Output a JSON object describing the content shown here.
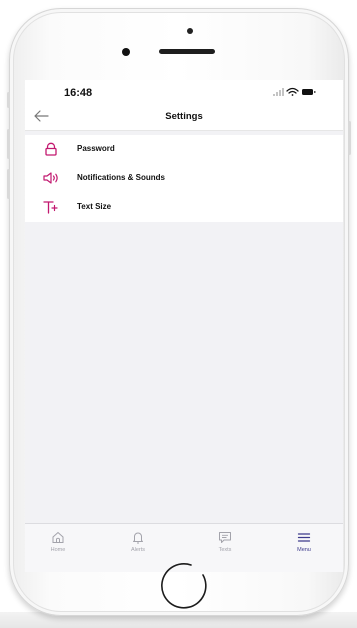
{
  "status_bar": {
    "time": "16:48"
  },
  "nav": {
    "title": "Settings",
    "back_icon": "arrow-left-icon"
  },
  "menu": {
    "items": [
      {
        "label": "Password",
        "icon": "lock-icon"
      },
      {
        "label": "Notifications & Sounds",
        "icon": "speaker-icon"
      },
      {
        "label": "Text Size",
        "icon": "text-size-icon"
      }
    ]
  },
  "tab_bar": {
    "tabs": [
      {
        "label": "Home",
        "icon": "home-icon",
        "active": false
      },
      {
        "label": "Alerts",
        "icon": "bell-icon",
        "active": false
      },
      {
        "label": "Texts",
        "icon": "message-icon",
        "active": false
      },
      {
        "label": "Menu",
        "icon": "menu-icon",
        "active": true
      }
    ]
  },
  "colors": {
    "accent": "#c2186f",
    "active_tab": "#3d3a8c",
    "inactive_tab": "#a3a3ab",
    "screen_background": "#f2f2f5"
  }
}
